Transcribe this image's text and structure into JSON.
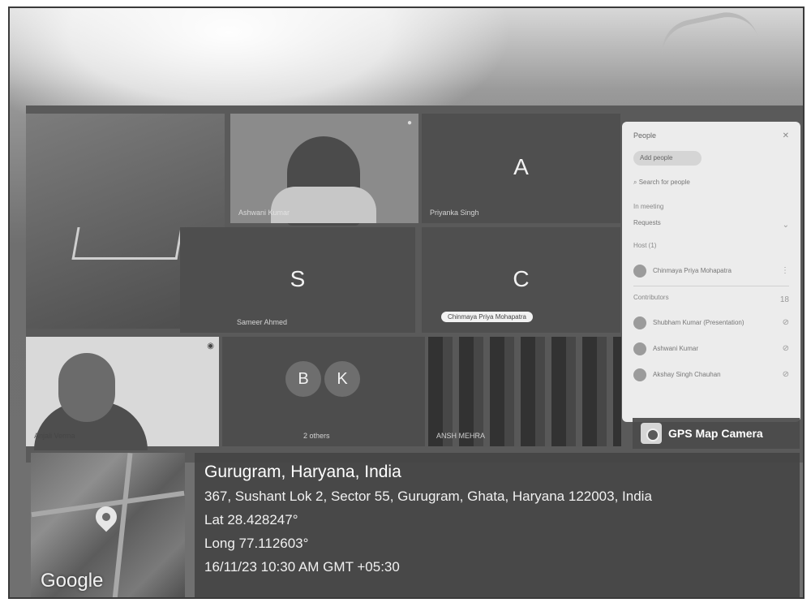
{
  "meeting": {
    "tiles": [
      {
        "name": ""
      },
      {
        "name": "Ashwani Kumar"
      },
      {
        "letter": "A",
        "name": "Priyanka Singh"
      },
      {
        "letter": "S",
        "name": "Sameer Ahmed"
      },
      {
        "letter": "C",
        "chip": "Chinmaya Priya Mohapatra"
      },
      {
        "name": "Anjali Verma"
      },
      {
        "avatars": [
          "B",
          "K"
        ],
        "name": "2 others"
      },
      {
        "name": "ANSH MEHRA"
      }
    ]
  },
  "people_panel": {
    "title": "People",
    "add_label": "Add people",
    "search_placeholder": "Search for people",
    "in_meeting": "In meeting",
    "requests": "Requests",
    "host_label": "Host (1)",
    "host_name": "Chinmaya Priya Mohapatra",
    "contributors": "Contributors",
    "contributors_count": "18",
    "participants": [
      "Shubham Kumar (Presentation)",
      "Ashwani Kumar",
      "Akshay Singh Chauhan"
    ]
  },
  "gps": {
    "badge": "GPS Map Camera",
    "map_brand": "Google",
    "city": "Gurugram, Haryana, India",
    "address": "367, Sushant Lok 2, Sector 55, Gurugram, Ghata, Haryana 122003, India",
    "lat": "Lat 28.428247°",
    "long": "Long 77.112603°",
    "datetime": "16/11/23 10:30 AM GMT +05:30"
  }
}
